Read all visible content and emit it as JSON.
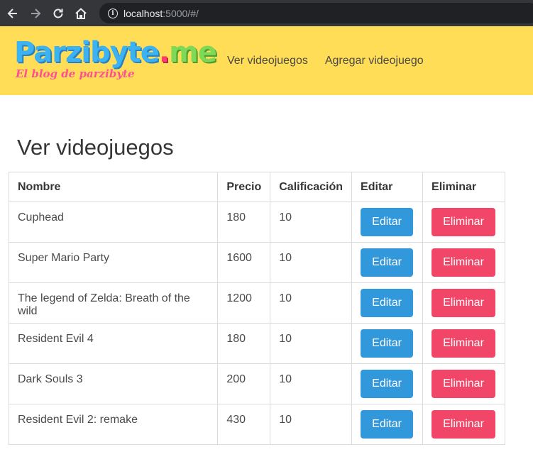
{
  "browser": {
    "url_host": "localhost",
    "url_path": ":5000/#/"
  },
  "brand": {
    "name_part1": "Parzibyte",
    "name_part2": ".",
    "name_part3": "me",
    "tagline": "El blog de parzibyte"
  },
  "nav": {
    "link_view": "Ver videojuegos",
    "link_add": "Agregar videojuego"
  },
  "page": {
    "title": "Ver videojuegos"
  },
  "table": {
    "headers": {
      "name": "Nombre",
      "price": "Precio",
      "rating": "Calificación",
      "edit": "Editar",
      "delete": "Eliminar"
    },
    "edit_label": "Editar",
    "delete_label": "Eliminar",
    "rows": [
      {
        "name": "Cuphead",
        "price": "180",
        "rating": "10"
      },
      {
        "name": "Super Mario Party",
        "price": "1600",
        "rating": "10"
      },
      {
        "name": "The legend of Zelda: Breath of the wild",
        "price": "1200",
        "rating": "10"
      },
      {
        "name": "Resident Evil 4",
        "price": "180",
        "rating": "10"
      },
      {
        "name": "Dark Souls 3",
        "price": "200",
        "rating": "10"
      },
      {
        "name": "Resident Evil 2: remake",
        "price": "430",
        "rating": "10"
      }
    ]
  },
  "colors": {
    "navbar_bg": "#ffdd57",
    "edit_button": "#3298dc",
    "delete_button": "#f14668"
  }
}
